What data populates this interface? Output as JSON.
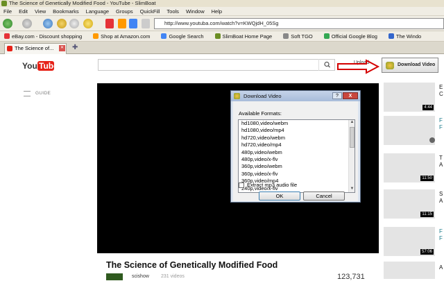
{
  "window": {
    "title": "The Science of Genetically Modified Food - YouTube - SlimBoat"
  },
  "menu": [
    "File",
    "Edit",
    "View",
    "Bookmarks",
    "Language",
    "Groups",
    "QuickFill",
    "Tools",
    "Window",
    "Help"
  ],
  "url": "http://www.youtuba.com/watch?v=KWQjdH_05Sg",
  "bookmarks": [
    {
      "label": "eBay.com - Discount shopping",
      "color": "#e53238"
    },
    {
      "label": "Shop at Amazon.com",
      "color": "#ff9900"
    },
    {
      "label": "Google Search",
      "color": "#4285f4"
    },
    {
      "label": "SlimBoat Home Page",
      "color": "#6b8e23"
    },
    {
      "label": "Soft TGO",
      "color": "#888888"
    },
    {
      "label": "Official Google Blog",
      "color": "#34a853"
    },
    {
      "label": "The Windo",
      "color": "#3366cc"
    }
  ],
  "tab": {
    "label": "The Science of..."
  },
  "youtube": {
    "logo": "YouTube",
    "upload": "Upload",
    "download_button": "Download Video",
    "guide": "GUIDE",
    "video_title": "The Science of Genetically Modified Food",
    "channel": "scishow",
    "channel_videos": "231 videos",
    "views": "123,731",
    "sidebar": [
      {
        "duration": "4:44",
        "lines": [
          "E",
          "C"
        ]
      },
      {
        "duration": "",
        "lines": [
          "F",
          "F"
        ]
      },
      {
        "duration": "11:50",
        "lines": [
          "T",
          "A"
        ]
      },
      {
        "duration": "11:15",
        "lines": [
          "S",
          "A"
        ]
      },
      {
        "duration": "57:06",
        "lines": [
          "F",
          "F"
        ]
      },
      {
        "duration": "",
        "lines": [
          "A"
        ]
      }
    ]
  },
  "dialog": {
    "title": "Download Video",
    "help": "?",
    "close": "X",
    "label": "Available Formats:",
    "formats": [
      "hd1080,video/webm",
      "hd1080,video/mp4",
      "hd720,video/webm",
      "hd720,video/mp4",
      "480p,video/webm",
      "480p,video/x-flv",
      "360p,video/webm",
      "360p,video/x-flv",
      "360p,video/mp4",
      "240p,video/x-flv"
    ],
    "checkbox_label": "Extract mp3 audio file",
    "ok": "OK",
    "cancel": "Cancel"
  },
  "colors": {
    "annotation_arrow": "#d40000",
    "youtube_red": "#e62117"
  }
}
